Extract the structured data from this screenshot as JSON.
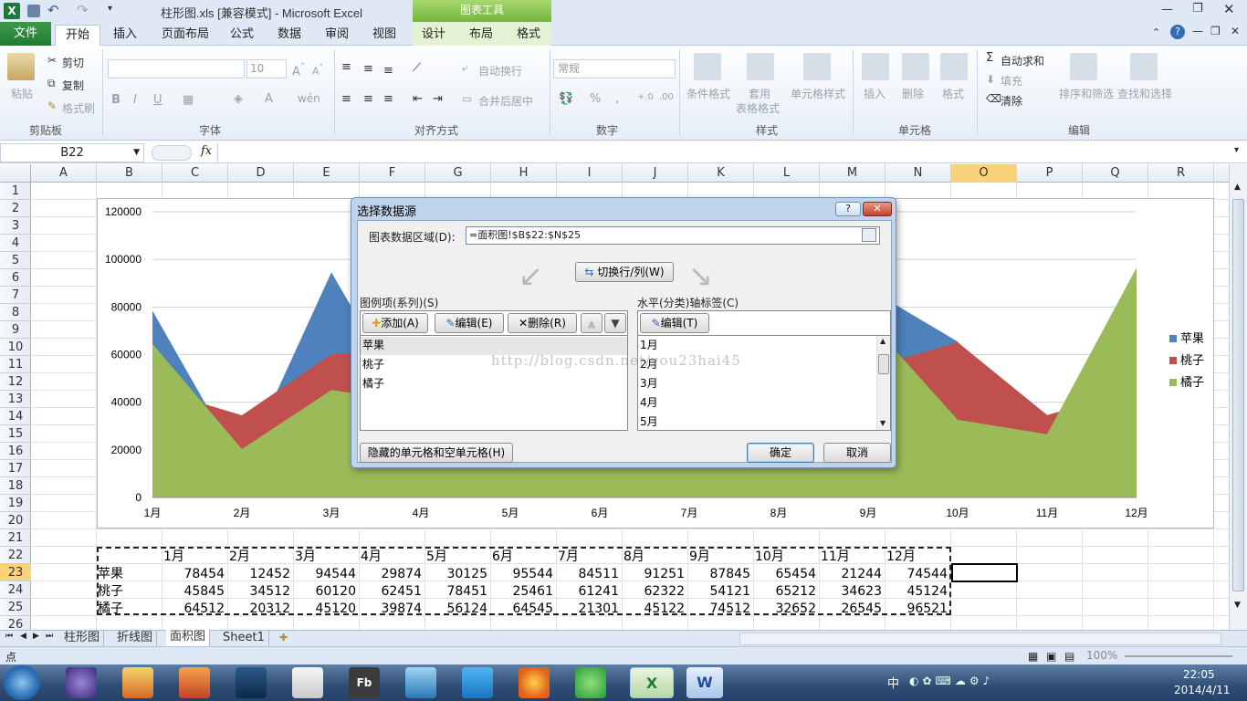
{
  "window": {
    "title": "柱形图.xls  [兼容模式]  -  Microsoft Excel",
    "chart_tools": "图表工具"
  },
  "tabs": {
    "file": "文件",
    "home": "开始",
    "insert": "插入",
    "layout": "页面布局",
    "formulas": "公式",
    "data": "数据",
    "review": "审阅",
    "view": "视图",
    "design": "设计",
    "chart_layout": "布局",
    "format": "格式"
  },
  "ribbon": {
    "clipboard": {
      "paste": "粘贴",
      "cut": "剪切",
      "copy": "复制",
      "format_painter": "格式刷",
      "group": "剪贴板"
    },
    "font": {
      "size": "10",
      "group": "字体"
    },
    "alignment": {
      "wrap": "自动换行",
      "merge": "合并后居中",
      "group": "对齐方式"
    },
    "number": {
      "format": "常规",
      "group": "数字"
    },
    "styles": {
      "conditional": "条件格式",
      "table_fmt_1": "套用",
      "table_fmt_2": "表格格式",
      "cell_styles": "单元格样式",
      "group": "样式"
    },
    "cells": {
      "insert": "插入",
      "delete": "删除",
      "format": "格式",
      "group": "单元格"
    },
    "editing": {
      "autosum": "自动求和",
      "fill": "填充",
      "clear": "清除",
      "sort": "排序和筛选",
      "find": "查找和选择",
      "group": "编辑"
    }
  },
  "formula_bar": {
    "name_box": "B22",
    "fx": "fx",
    "content": ""
  },
  "columns": [
    "A",
    "B",
    "C",
    "D",
    "E",
    "F",
    "G",
    "H",
    "I",
    "J",
    "K",
    "L",
    "M",
    "N",
    "O",
    "P",
    "Q",
    "R"
  ],
  "rows": [
    "1",
    "2",
    "3",
    "4",
    "5",
    "6",
    "7",
    "8",
    "9",
    "10",
    "11",
    "12",
    "13",
    "14",
    "15",
    "16",
    "17",
    "18",
    "19",
    "20",
    "21",
    "22",
    "23",
    "24",
    "25",
    "26"
  ],
  "table": {
    "months": [
      "1月",
      "2月",
      "3月",
      "4月",
      "5月",
      "6月",
      "7月",
      "8月",
      "9月",
      "10月",
      "11月",
      "12月"
    ],
    "rows": [
      {
        "name": "苹果",
        "values": [
          "78454",
          "12452",
          "94544",
          "29874",
          "30125",
          "95544",
          "84511",
          "91251",
          "87845",
          "65454",
          "21244",
          "74544"
        ]
      },
      {
        "name": "桃子",
        "values": [
          "45845",
          "34512",
          "60120",
          "62451",
          "78451",
          "25461",
          "61241",
          "62322",
          "54121",
          "65212",
          "34623",
          "45124"
        ]
      },
      {
        "name": "橘子",
        "values": [
          "64512",
          "20312",
          "45120",
          "39874",
          "56124",
          "64545",
          "21301",
          "45122",
          "74512",
          "32652",
          "26545",
          "96521"
        ]
      }
    ]
  },
  "chart_data": {
    "type": "area",
    "categories": [
      "1月",
      "2月",
      "3月",
      "4月",
      "5月",
      "6月",
      "7月",
      "8月",
      "9月",
      "10月",
      "11月",
      "12月"
    ],
    "series": [
      {
        "name": "苹果",
        "color": "#4f81bd",
        "values": [
          78454,
          12452,
          94544,
          29874,
          30125,
          95544,
          84511,
          91251,
          87845,
          65454,
          21244,
          74544
        ]
      },
      {
        "name": "桃子",
        "color": "#c0504d",
        "values": [
          45845,
          34512,
          60120,
          62451,
          78451,
          25461,
          61241,
          62322,
          54121,
          65212,
          34623,
          45124
        ]
      },
      {
        "name": "橘子",
        "color": "#9bbb59",
        "values": [
          64512,
          20312,
          45120,
          39874,
          56124,
          64545,
          21301,
          45122,
          74512,
          32652,
          26545,
          96521
        ]
      }
    ],
    "yticks": [
      "0",
      "20000",
      "40000",
      "60000",
      "80000",
      "100000",
      "120000"
    ],
    "ylim": [
      0,
      120000
    ],
    "grid": true,
    "legend": "right"
  },
  "dialog": {
    "title": "选择数据源",
    "help": "?",
    "range_label": "图表数据区域(D):",
    "range_value": "=面积图!$B$22:$N$25",
    "switch_button": "切换行/列(W)",
    "legend_label": "图例项(系列)(S)",
    "add": "添加(A)",
    "edit": "编辑(E)",
    "remove": "删除(R)",
    "series": [
      "苹果",
      "桃子",
      "橘子"
    ],
    "axis_label": "水平(分类)轴标签(C)",
    "axis_edit": "编辑(T)",
    "axis_items": [
      "1月",
      "2月",
      "3月",
      "4月",
      "5月"
    ],
    "hidden_cells": "隐藏的单元格和空单元格(H)",
    "ok": "确定",
    "cancel": "取消"
  },
  "watermark": "http://blog.csdn.net/you23hai45",
  "sheets": [
    "柱形图",
    "折线图",
    "面积图",
    "Sheet1"
  ],
  "status": {
    "mode": "点",
    "zoom": "100%"
  },
  "taskbar": {
    "time": "22:05",
    "date": "2014/4/11",
    "ime": "中"
  }
}
